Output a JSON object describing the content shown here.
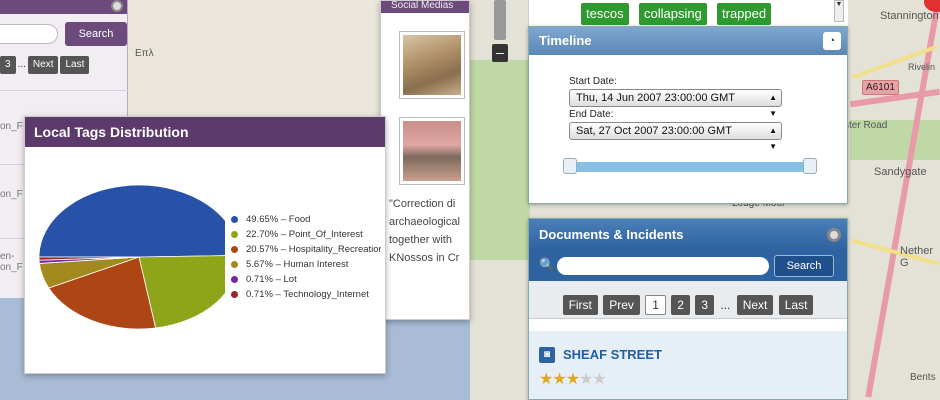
{
  "map": {
    "labels": {
      "stannington": "Stannington",
      "rivelin": "Rivelin",
      "a6101": "A6101",
      "ster_road": "ster Road",
      "sandygate": "Sandygate",
      "nether": "Nether G",
      "lodge_moor": "Lodge Moor",
      "bents": "Bents",
      "greek": "Επλ"
    },
    "zoom_out": "–"
  },
  "back_panel": {
    "search_button": "Search",
    "pager": [
      "3",
      "...",
      "Next",
      "Last"
    ],
    "rows": [
      "on_F",
      "on_F",
      "en-\non_F"
    ]
  },
  "tags_panel": {
    "title": "Local Tags Distribution",
    "legend": [
      {
        "label": "49.65% – Food",
        "color": "#2752a8"
      },
      {
        "label": "22.70% – Point_Of_Interest",
        "color": "#8ea419"
      },
      {
        "label": "20.57% – Hospitality_Recreation",
        "color": "#ad4515"
      },
      {
        "label": "5.67% – Human Interest",
        "color": "#a28a1d"
      },
      {
        "label": "0.71% – Lot",
        "color": "#7525a8"
      },
      {
        "label": "0.71% – Technology_Internet",
        "color": "#a02327"
      }
    ]
  },
  "chart_data": {
    "type": "pie",
    "categories": [
      "Food",
      "Point_Of_Interest",
      "Hospitality_Recreation",
      "Human Interest",
      "Lot",
      "Technology_Internet"
    ],
    "values": [
      49.65,
      22.7,
      20.57,
      5.67,
      0.71,
      0.71
    ],
    "colors": [
      "#2752a8",
      "#8ea419",
      "#ad4515",
      "#a28a1d",
      "#7525a8",
      "#a02327"
    ],
    "title": "Local Tags Distribution",
    "legend_position": "right"
  },
  "social_panel": {
    "title": "Social Medias",
    "text_lines": [
      "\"Correction di",
      "archaeological",
      "together with",
      "KNossos in Cr"
    ]
  },
  "tags_top": [
    "tescos",
    "collapsing",
    "trapped"
  ],
  "timeline": {
    "title": "Timeline",
    "start_label": "Start Date:",
    "start_value": "Thu, 14 Jun 2007 23:00:00 GMT",
    "end_label": "End Date:",
    "end_value": "Sat, 27 Oct 2007 23:00:00 GMT"
  },
  "documents": {
    "title": "Documents & Incidents",
    "search_button": "Search",
    "pager": {
      "first": "First",
      "prev": "Prev",
      "pages": [
        "1",
        "2",
        "3"
      ],
      "ellipsis": "...",
      "next": "Next",
      "last": "Last"
    },
    "items": [
      {
        "name": "SHEAF STREET",
        "rating": 3,
        "max_rating": 5
      }
    ]
  }
}
